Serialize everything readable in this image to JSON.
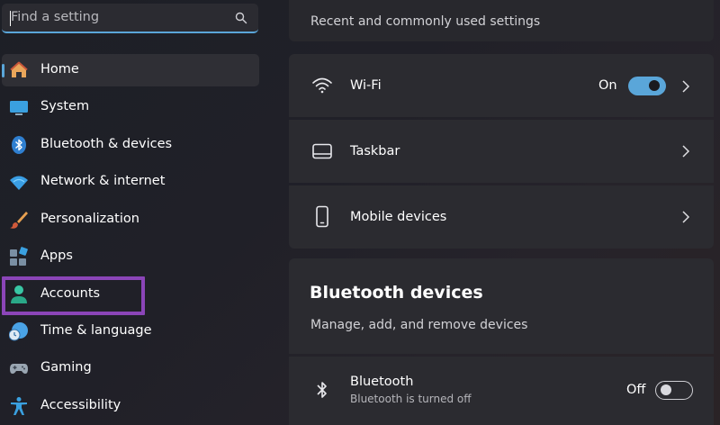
{
  "search": {
    "placeholder": "Find a setting"
  },
  "sidebar": {
    "items": [
      {
        "label": "Home",
        "icon": "home-icon"
      },
      {
        "label": "System",
        "icon": "monitor-icon"
      },
      {
        "label": "Bluetooth & devices",
        "icon": "bluetooth-icon"
      },
      {
        "label": "Network & internet",
        "icon": "wifi-icon"
      },
      {
        "label": "Personalization",
        "icon": "brush-icon"
      },
      {
        "label": "Apps",
        "icon": "apps-icon"
      },
      {
        "label": "Accounts",
        "icon": "person-icon"
      },
      {
        "label": "Time & language",
        "icon": "globe-clock-icon"
      },
      {
        "label": "Gaming",
        "icon": "gamepad-icon"
      },
      {
        "label": "Accessibility",
        "icon": "accessibility-icon"
      }
    ],
    "selected": "Home",
    "highlighted": "Accounts"
  },
  "main": {
    "recent_subtitle": "Recent and commonly used settings",
    "recent_items": [
      {
        "label": "Wi-Fi",
        "icon": "wifi-icon",
        "toggle_text": "On",
        "toggle_on": true
      },
      {
        "label": "Taskbar",
        "icon": "taskbar-icon"
      },
      {
        "label": "Mobile devices",
        "icon": "phone-icon"
      }
    ],
    "bluetooth_section": {
      "title": "Bluetooth devices",
      "subtitle": "Manage, add, and remove devices",
      "item": {
        "label": "Bluetooth",
        "sublabel": "Bluetooth is turned off",
        "icon": "bluetooth-icon",
        "toggle_text": "Off",
        "toggle_on": false
      }
    }
  },
  "colors": {
    "accent": "#5aa6d9",
    "highlight_box": "#8b45b8",
    "card": "#2b2b30"
  }
}
